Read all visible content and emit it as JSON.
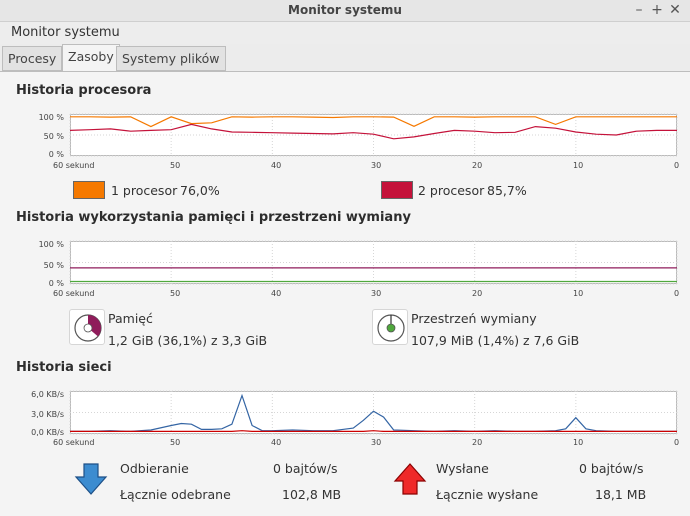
{
  "window": {
    "title": "Monitor systemu"
  },
  "menu": {
    "label": "Monitor systemu"
  },
  "tabs": [
    {
      "label": "Procesy"
    },
    {
      "label": "Zasoby"
    },
    {
      "label": "Systemy plików"
    }
  ],
  "cpu": {
    "title": "Historia procesora",
    "y_ticks": [
      "100 %",
      "50 %",
      "0 %"
    ],
    "x_ticks": [
      "60 sekund",
      "50",
      "40",
      "30",
      "20",
      "10",
      "0"
    ],
    "cpu1": {
      "label": "1 procesor",
      "value": "76,0%",
      "color": "#f57900"
    },
    "cpu2": {
      "label": "2 procesor",
      "value": "85,7%",
      "color": "#c4123a"
    }
  },
  "memory": {
    "title": "Historia wykorzystania pamięci i przestrzeni wymiany",
    "y_ticks": [
      "100 %",
      "50 %",
      "0 %"
    ],
    "x_ticks": [
      "60 sekund",
      "50",
      "40",
      "30",
      "20",
      "10",
      "0"
    ],
    "mem": {
      "label": "Pamięć",
      "value": "1,2 GiB (36,1%) z 3,3 GiB",
      "color": "#8f1c5b",
      "fraction": 0.361
    },
    "swap": {
      "label": "Przestrzeń wymiany",
      "value": "107,9 MiB (1,4%) z 7,6 GiB",
      "color": "#4fa83d",
      "fraction": 0.014
    }
  },
  "network": {
    "title": "Historia sieci",
    "y_ticks": [
      "6,0 KB/s",
      "3,0 KB/s",
      "0,0 KB/s"
    ],
    "x_ticks": [
      "60 sekund",
      "50",
      "40",
      "30",
      "20",
      "10",
      "0"
    ],
    "recv": {
      "label": "Odbieranie",
      "rate": "0 bajtów/s",
      "total_label": "Łącznie odebrane",
      "total": "102,8 MB",
      "color": "#3465a4"
    },
    "send": {
      "label": "Wysłane",
      "rate": "0 bajtów/s",
      "total_label": "Łącznie wysłane",
      "total": "18,1 MB",
      "color": "#cc0000"
    }
  },
  "chart_data": [
    {
      "type": "line",
      "title": "Historia procesora",
      "xlabel": "",
      "ylabel": "",
      "x": [
        60,
        58,
        56,
        54,
        52,
        50,
        48,
        46,
        44,
        42,
        40,
        38,
        36,
        34,
        32,
        30,
        28,
        26,
        24,
        22,
        20,
        18,
        16,
        14,
        12,
        10,
        8,
        6,
        4,
        2,
        0
      ],
      "xlim": [
        60,
        0
      ],
      "ylim": [
        0,
        100
      ],
      "series": [
        {
          "name": "1 procesor",
          "values": [
            98,
            98,
            97,
            98,
            72,
            98,
            80,
            82,
            98,
            97,
            98,
            98,
            97,
            96,
            98,
            98,
            97,
            73,
            98,
            98,
            97,
            98,
            98,
            98,
            78,
            98,
            98,
            98,
            98,
            98,
            98
          ]
        },
        {
          "name": "2 procesor",
          "values": [
            62,
            64,
            66,
            60,
            62,
            64,
            78,
            66,
            58,
            57,
            56,
            55,
            54,
            53,
            56,
            52,
            40,
            45,
            54,
            62,
            60,
            56,
            57,
            72,
            68,
            58,
            52,
            50,
            60,
            62,
            62
          ]
        }
      ]
    },
    {
      "type": "line",
      "title": "Historia wykorzystania pamięci i przestrzeni wymiany",
      "x": [
        60,
        0
      ],
      "xlim": [
        60,
        0
      ],
      "ylim": [
        0,
        100
      ],
      "series": [
        {
          "name": "Pamięć",
          "values": [
            36.1,
            36.1
          ]
        },
        {
          "name": "Przestrzeń wymiany",
          "values": [
            1.4,
            1.4
          ]
        }
      ]
    },
    {
      "type": "line",
      "title": "Historia sieci",
      "x": [
        60,
        58,
        56,
        54,
        52,
        50,
        49,
        48,
        47,
        46,
        45,
        44,
        43,
        42,
        41,
        40,
        38,
        36,
        34,
        32,
        31,
        30,
        29,
        28,
        26,
        24,
        22,
        20,
        18,
        16,
        14,
        12,
        11,
        10,
        9,
        8,
        6,
        4,
        2,
        0
      ],
      "xlim": [
        60,
        0
      ],
      "ylim": [
        0,
        6
      ],
      "series": [
        {
          "name": "Odbieranie",
          "values": [
            0.1,
            0.1,
            0.2,
            0.1,
            0.3,
            1.0,
            1.3,
            1.2,
            0.4,
            0.4,
            0.5,
            1.2,
            5.6,
            1.0,
            0.2,
            0.2,
            0.3,
            0.2,
            0.2,
            0.6,
            1.8,
            3.2,
            2.3,
            0.3,
            0.2,
            0.1,
            0.2,
            0.1,
            0.2,
            0.1,
            0.1,
            0.2,
            0.5,
            2.2,
            0.5,
            0.2,
            0.1,
            0.1,
            0.1,
            0.1
          ]
        },
        {
          "name": "Wysłane",
          "values": [
            0.1,
            0.1,
            0.1,
            0.1,
            0.1,
            0.1,
            0.1,
            0.1,
            0.1,
            0.1,
            0.1,
            0.1,
            0.2,
            0.1,
            0.1,
            0.1,
            0.1,
            0.1,
            0.1,
            0.1,
            0.1,
            0.2,
            0.1,
            0.1,
            0.1,
            0.1,
            0.1,
            0.1,
            0.1,
            0.1,
            0.1,
            0.1,
            0.1,
            0.1,
            0.1,
            0.1,
            0.1,
            0.1,
            0.1,
            0.1
          ]
        }
      ]
    }
  ]
}
